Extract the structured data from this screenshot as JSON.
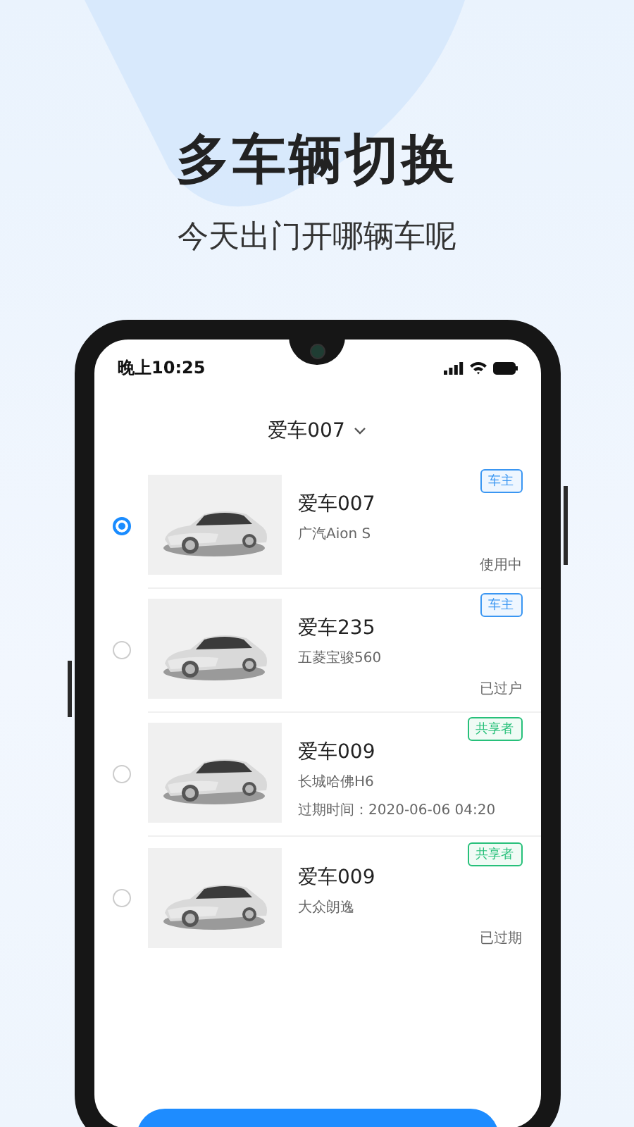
{
  "headline": "多车辆切换",
  "subtitle": "今天出门开哪辆车呢",
  "status_bar": {
    "time": "晚上10:25"
  },
  "header": {
    "title": "爱车007"
  },
  "vehicles": [
    {
      "name": "爱车007",
      "model": "广汽Aion S",
      "role": {
        "label": "车主",
        "kind": "owner"
      },
      "status": "使用中",
      "selected": true
    },
    {
      "name": "爱车235",
      "model": "五菱宝骏560",
      "role": {
        "label": "车主",
        "kind": "owner"
      },
      "status": "已过户",
      "selected": false
    },
    {
      "name": "爱车009",
      "model": "长城哈佛H6",
      "role": {
        "label": "共享者",
        "kind": "sharer"
      },
      "status": "过期时间：2020-06-06 04:20",
      "selected": false
    },
    {
      "name": "爱车009",
      "model": "大众朗逸",
      "role": {
        "label": "共享者",
        "kind": "sharer"
      },
      "status": "已过期",
      "selected": false
    }
  ]
}
